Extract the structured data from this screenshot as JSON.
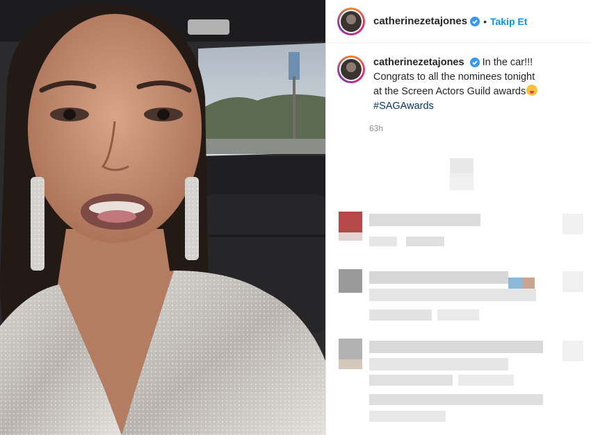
{
  "post": {
    "username": "catherinezetajones",
    "follow_label": "Takip Et",
    "separator": "•",
    "caption_line1": "In the car!!!",
    "caption_line2": "Congrats to all the nominees tonight",
    "caption_line3": "at the Screen Actors Guild awards",
    "hashtag": "#SAGAwards",
    "timestamp": "63h"
  },
  "colors": {
    "follow": "#0095f6",
    "hashtag": "#00376b",
    "verified": "#3897f0"
  }
}
